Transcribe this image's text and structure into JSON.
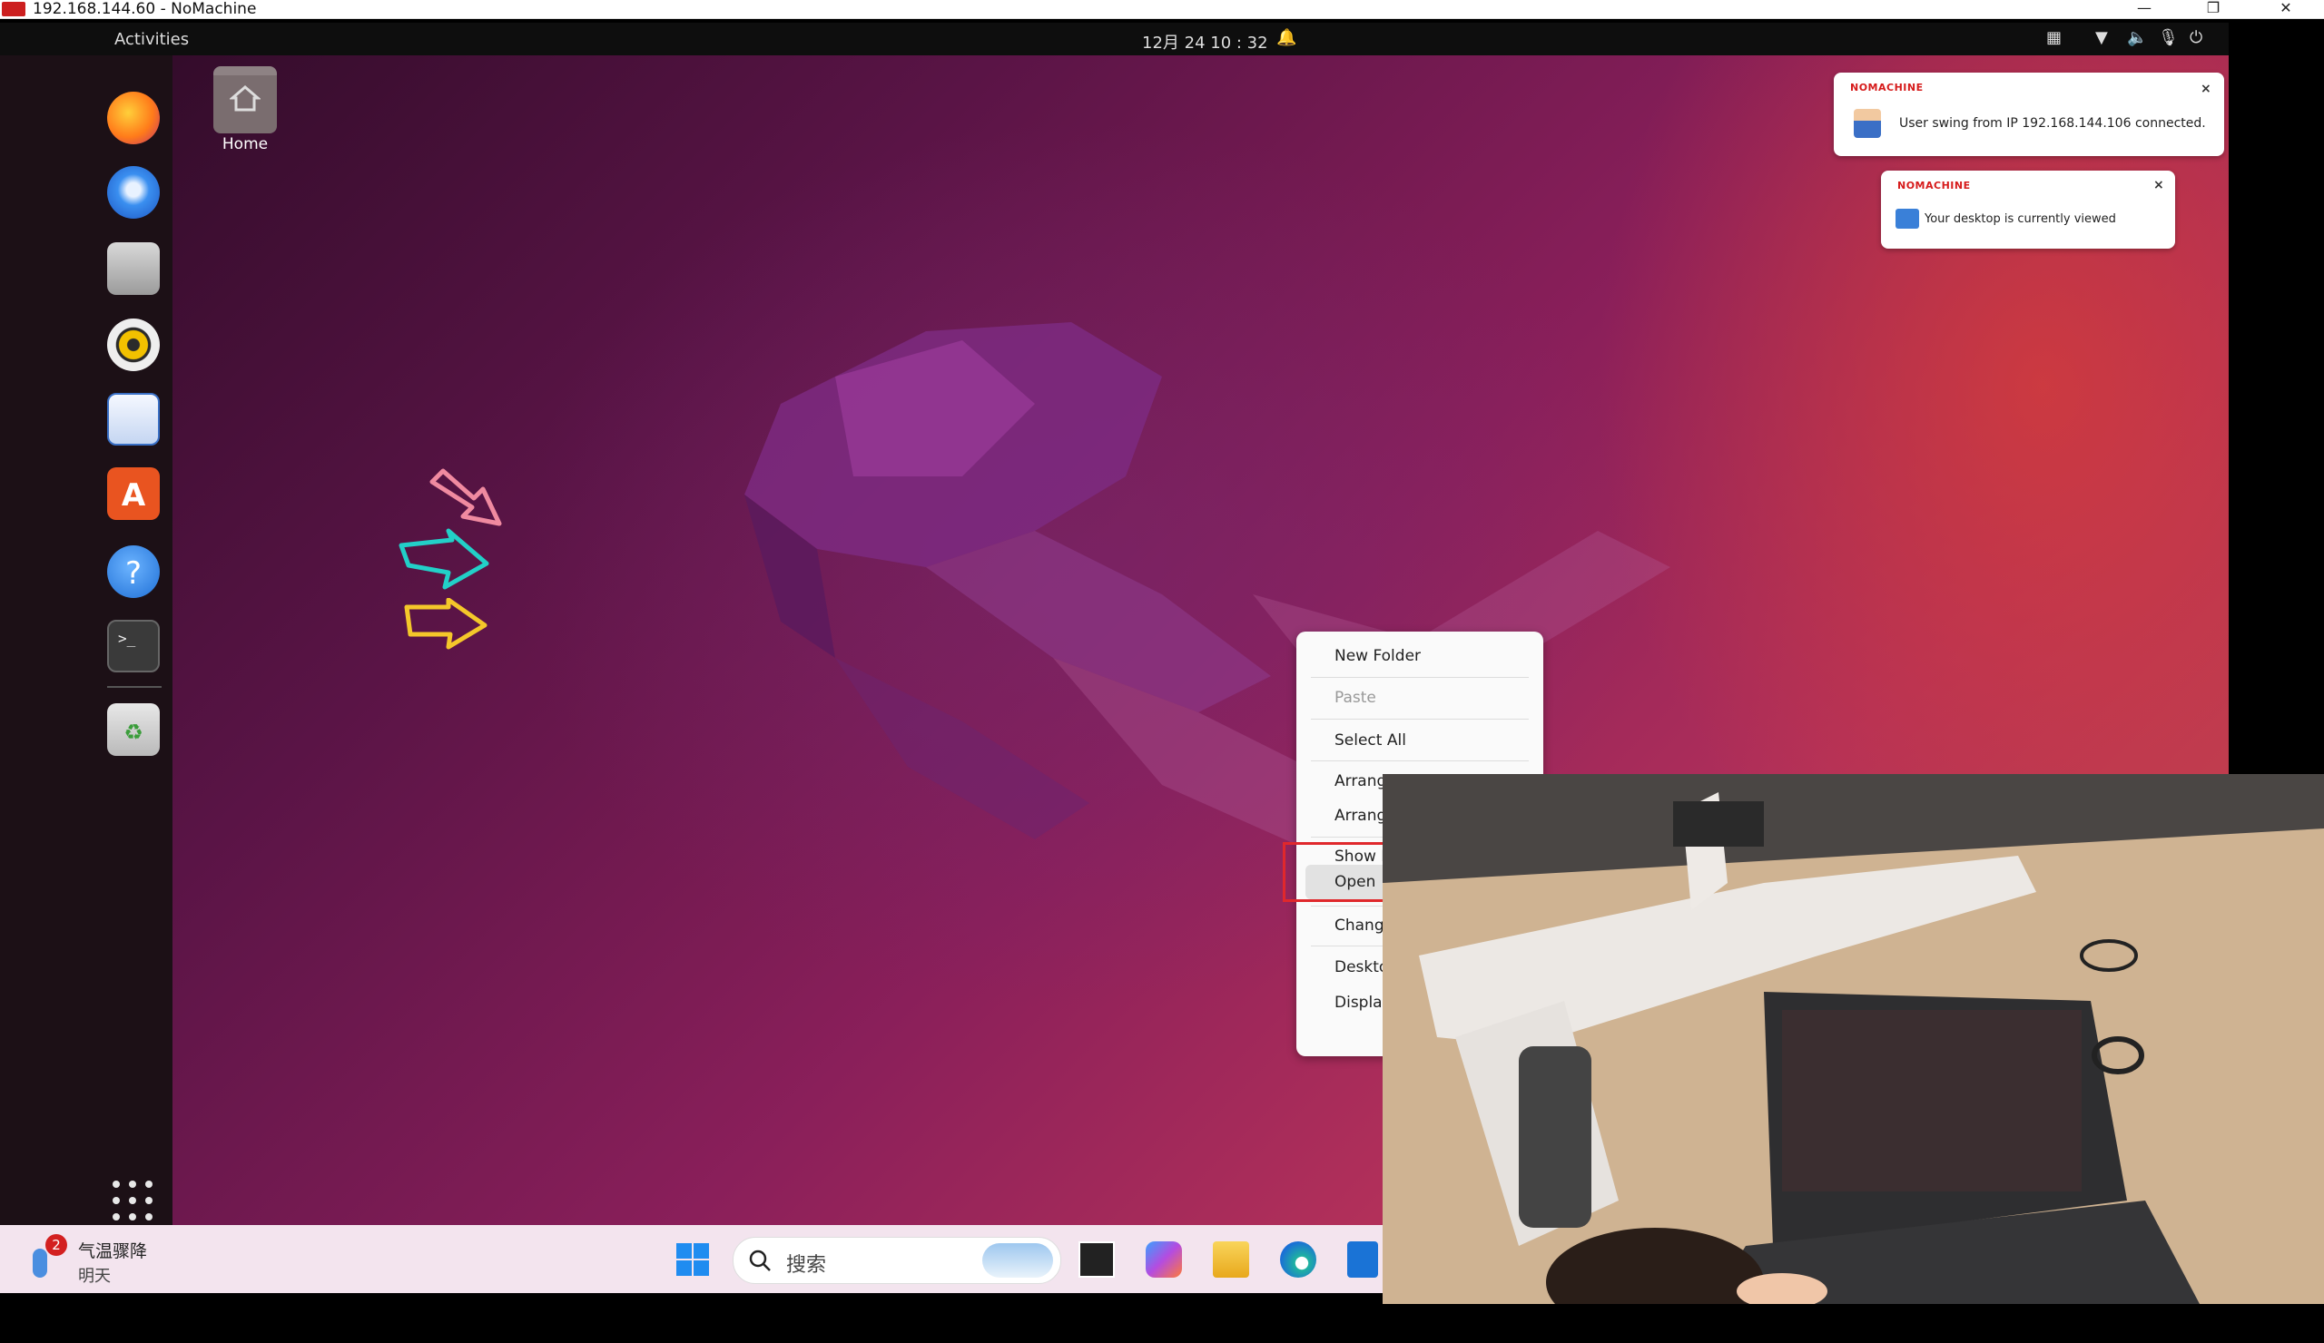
{
  "window": {
    "title": "192.168.144.60 - NoMachine",
    "minimize": "—",
    "restore": "❐",
    "close": "✕"
  },
  "topbar": {
    "activities": "Activities",
    "clock": "12月 24  10 : 32"
  },
  "dock": {
    "items": [
      "firefox-icon",
      "thunderbird-icon",
      "files-icon",
      "rhythmbox-icon",
      "writer-icon",
      "app-center-icon",
      "help-icon",
      "terminal-icon",
      "trash-icon"
    ]
  },
  "desktop": {
    "home_label": "Home"
  },
  "notifications": [
    {
      "brand": "NOMACHINE",
      "message": "User swing from IP 192.168.144.106 connected."
    },
    {
      "brand": "NOMACHINE",
      "message": "Your desktop is currently viewed"
    }
  ],
  "context_menu": {
    "items": [
      "New Folder",
      "Paste",
      "Select All",
      "Arrang",
      "Arrang",
      "Show D",
      "Open",
      "Chang",
      "Deskto",
      "Displa"
    ],
    "disabled": [
      "Paste"
    ],
    "highlighted": "Open"
  },
  "taskbar": {
    "weather_badge": "2",
    "weather_title": "气温骤降",
    "weather_sub": "明天",
    "search_text": "搜索"
  },
  "colors": {
    "nomachine_red": "#d61b1b",
    "highlight_box": "#e0282c",
    "ubuntu_orange": "#e95420"
  }
}
